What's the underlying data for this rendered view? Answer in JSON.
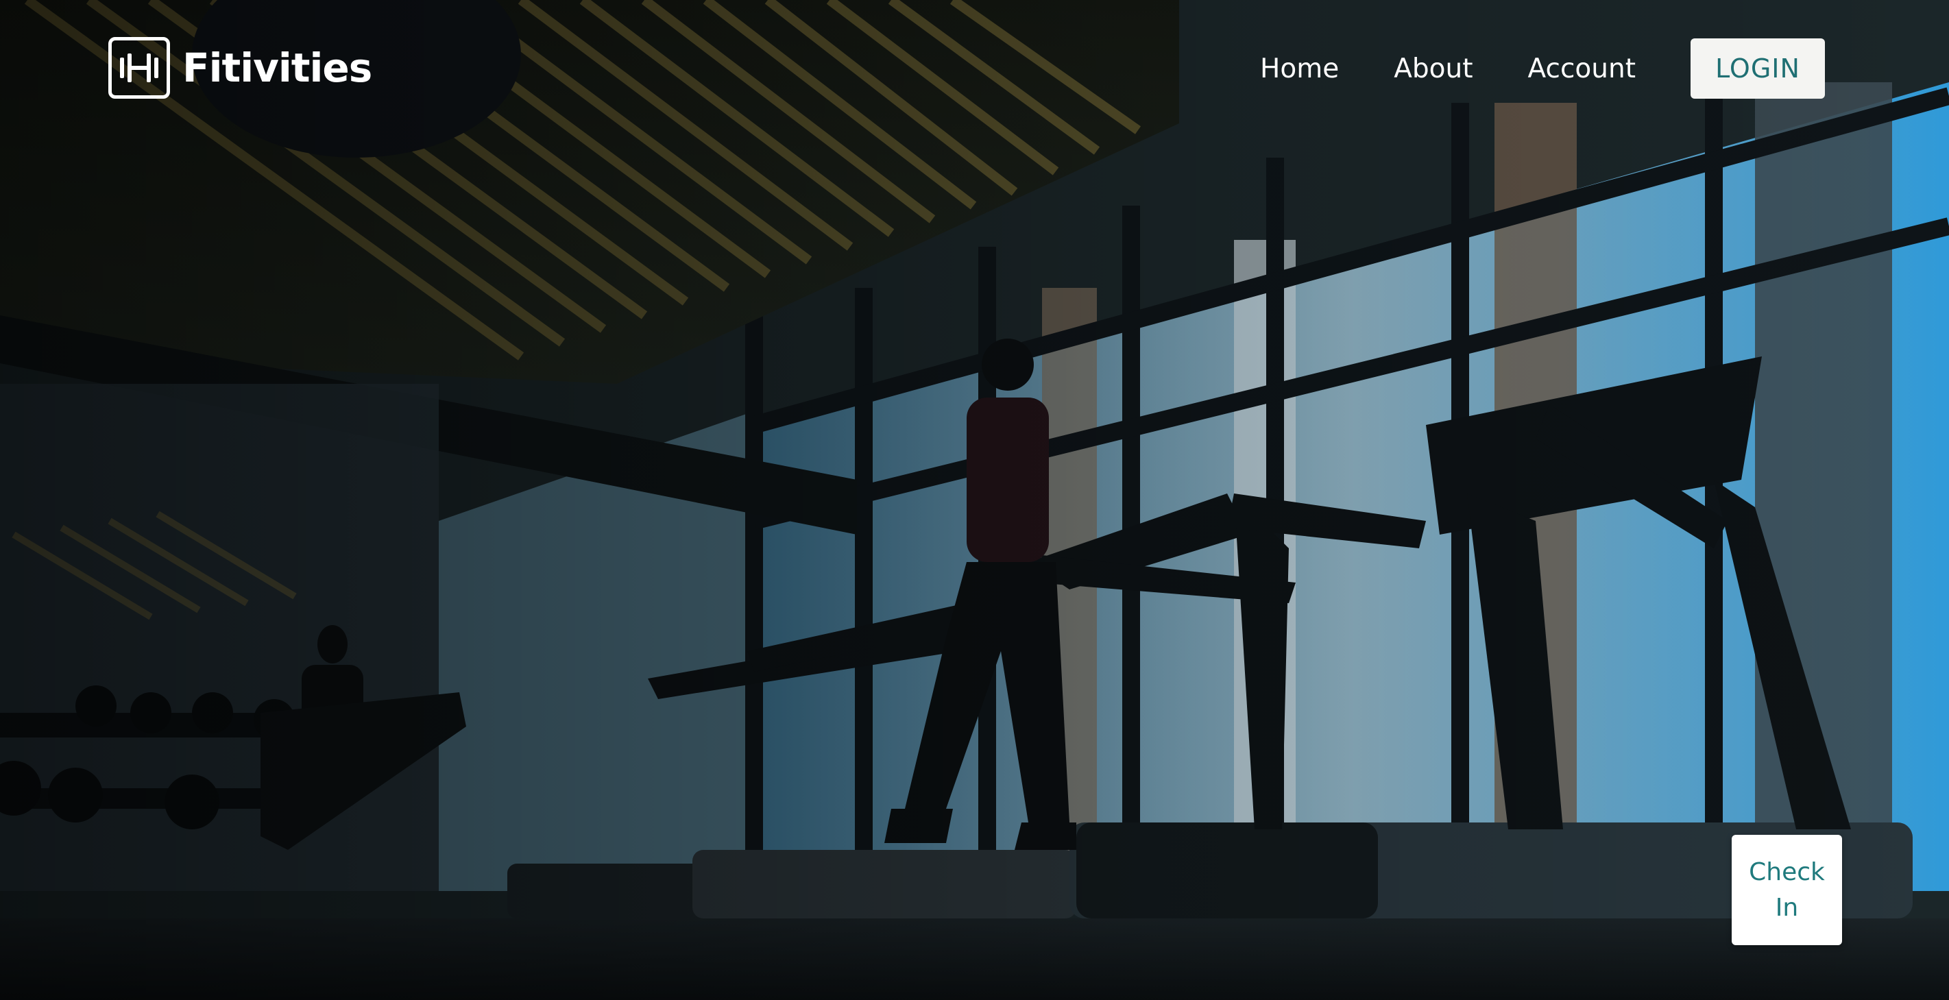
{
  "colors": {
    "accent": "#1f6f73",
    "nav_text": "#ffffff",
    "button_bg": "#f4f4f2"
  },
  "header": {
    "brand_name": "Fitivities",
    "logo_icon": "dumbbell-icon",
    "nav": {
      "home": "Home",
      "about": "About",
      "account": "Account"
    },
    "login_label": "LOGIN"
  },
  "hero": {
    "image": "gym-treadmill-photo"
  },
  "checkin": {
    "line1": "Check",
    "line2": "In"
  }
}
